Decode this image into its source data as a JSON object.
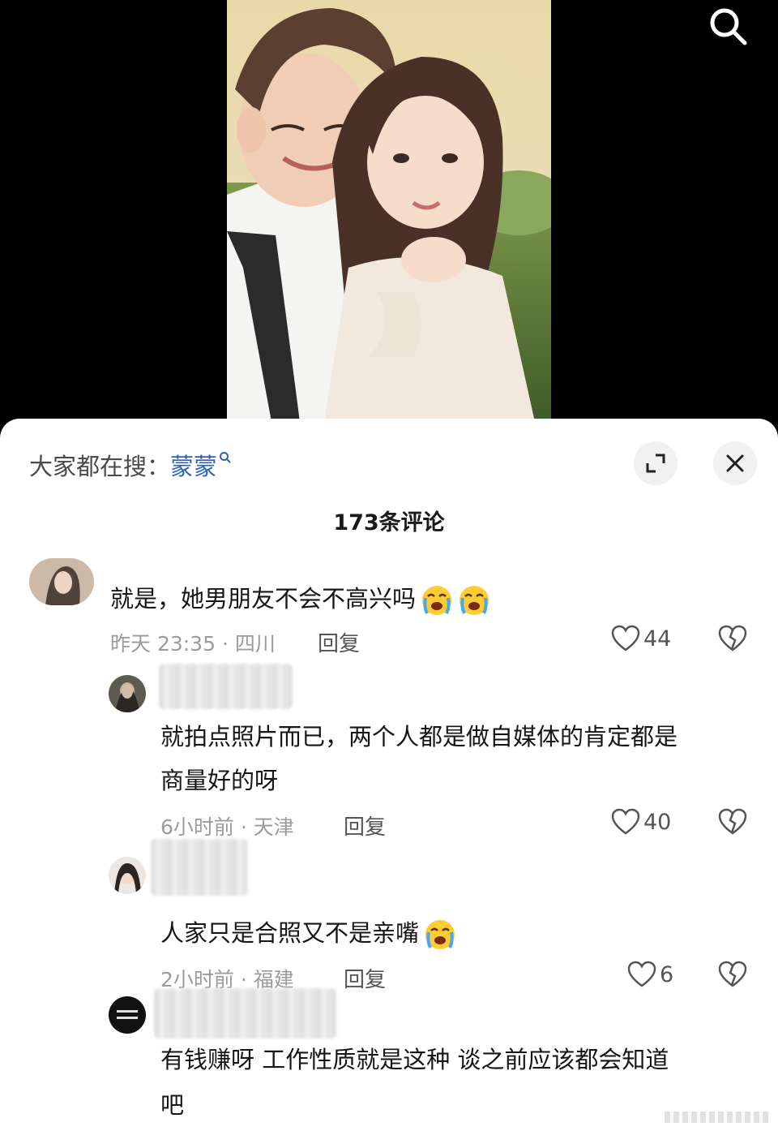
{
  "hot_search": {
    "prefix": "大家都在搜：",
    "keyword": "蒙蒙"
  },
  "comments_header": {
    "count_label": "173条评论"
  },
  "comments": [
    {
      "text": "就是，她男朋友不会不高兴吗",
      "meta": "昨天 23:35 · 四川",
      "reply_label": "回复",
      "likes": "44",
      "emoji": [
        "loudly-crying-face-emoji",
        "loudly-crying-face-emoji"
      ]
    },
    {
      "text_line1": "就拍点照片而已，两个人都是做自媒体的肯定都是",
      "text_line2": "商量好的呀",
      "meta": "6小时前 · 天津",
      "reply_label": "回复",
      "likes": "40"
    },
    {
      "text": "人家只是合照又不是亲嘴",
      "meta": "2小时前 · 福建",
      "reply_label": "回复",
      "likes": "6",
      "emoji": [
        "loudly-crying-face-emoji"
      ]
    },
    {
      "text_line1": "有钱赚呀 工作性质就是这种 谈之前应该都会知道",
      "text_line2": "吧"
    }
  ],
  "colors": {
    "keyword": "#2a63b5",
    "meta": "#9b9b9b",
    "text": "#161616"
  },
  "icons": [
    "search-icon",
    "expand-icon",
    "close-icon",
    "heart-icon",
    "broken-heart-icon"
  ]
}
